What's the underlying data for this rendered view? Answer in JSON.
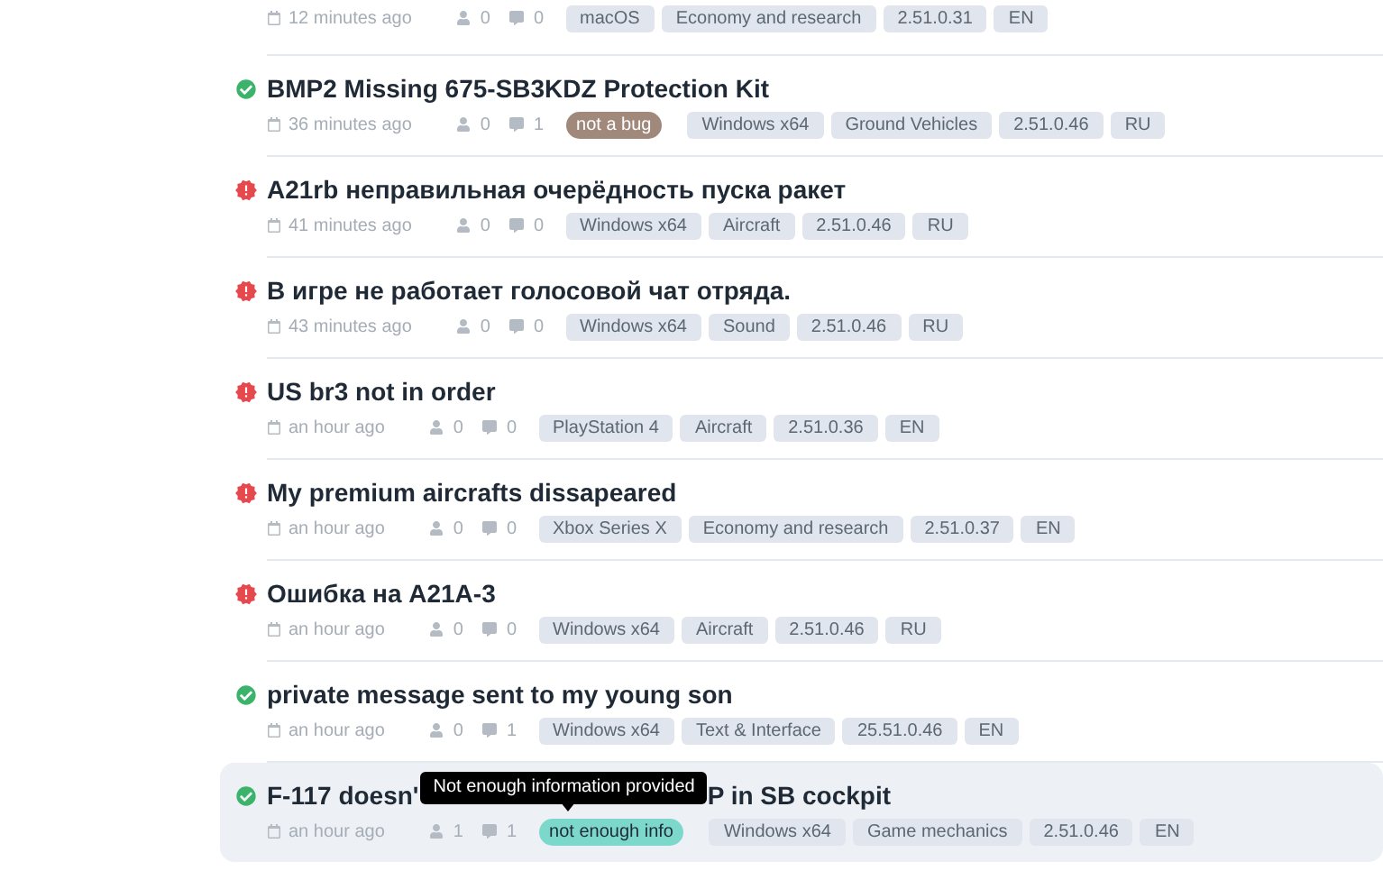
{
  "issues": [
    {
      "time": "12 minutes ago",
      "votes": "0",
      "comments": "0",
      "tags": [
        "macOS",
        "Economy and research",
        "2.51.0.31",
        "EN"
      ],
      "hovered": false
    },
    {
      "kind": "resolved",
      "title": [
        "BMP2 Missing 675-SB3KDZ Protection Kit"
      ],
      "time": "36 minutes ago",
      "votes": "0",
      "comments": "1",
      "resolution": {
        "label": "not a bug",
        "color": "#a0887a"
      },
      "tags": [
        "Windows x64",
        "Ground Vehicles",
        "2.51.0.46",
        "RU"
      ],
      "hovered": false
    },
    {
      "kind": "open",
      "title": [
        "A21rb неправильная очерёдность пуска ракет"
      ],
      "time": "41 minutes ago",
      "votes": "0",
      "comments": "0",
      "tags": [
        "Windows x64",
        "Aircraft",
        "2.51.0.46",
        "RU"
      ],
      "hovered": false
    },
    {
      "kind": "open",
      "title": [
        "В игре не работает голосовой чат отряда."
      ],
      "time": "43 minutes ago",
      "votes": "0",
      "comments": "0",
      "tags": [
        "Windows x64",
        "Sound",
        "2.51.0.46",
        "RU"
      ],
      "hovered": false
    },
    {
      "kind": "open",
      "title": [
        "US br3 not in order"
      ],
      "time": "an hour ago",
      "votes": "0",
      "comments": "0",
      "tags": [
        "PlayStation 4",
        "Aircraft",
        "2.51.0.36",
        "EN"
      ],
      "hovered": false
    },
    {
      "kind": "open",
      "title": [
        "My premium aircrafts dissapeared"
      ],
      "time": "an hour ago",
      "votes": "0",
      "comments": "0",
      "tags": [
        "Xbox Series X",
        "Economy and research",
        "2.51.0.37",
        "EN"
      ],
      "hovered": false
    },
    {
      "kind": "open",
      "title": [
        "Ошибка на A21A-3"
      ],
      "time": "an hour ago",
      "votes": "0",
      "comments": "0",
      "tags": [
        "Windows x64",
        "Aircraft",
        "2.51.0.46",
        "RU"
      ],
      "hovered": false
    },
    {
      "kind": "resolved",
      "title": [
        "private message sent to my young son"
      ],
      "time": "an hour ago",
      "votes": "0",
      "comments": "1",
      "tags": [
        "Windows x64",
        "Text & Interface",
        "25.51.0.46",
        "EN"
      ],
      "hovered": false
    },
    {
      "kind": "resolved",
      "title": [
        "F-117 doesn'",
        "P in SB cockpit"
      ],
      "time": "an hour ago",
      "votes": "1",
      "comments": "1",
      "resolution": {
        "label": "not enough info",
        "color": "#7dd8cc",
        "tooltip": "Not enough information provided"
      },
      "tags": [
        "Windows x64",
        "Game mechanics",
        "2.51.0.46",
        "EN"
      ],
      "hovered": true
    }
  ]
}
